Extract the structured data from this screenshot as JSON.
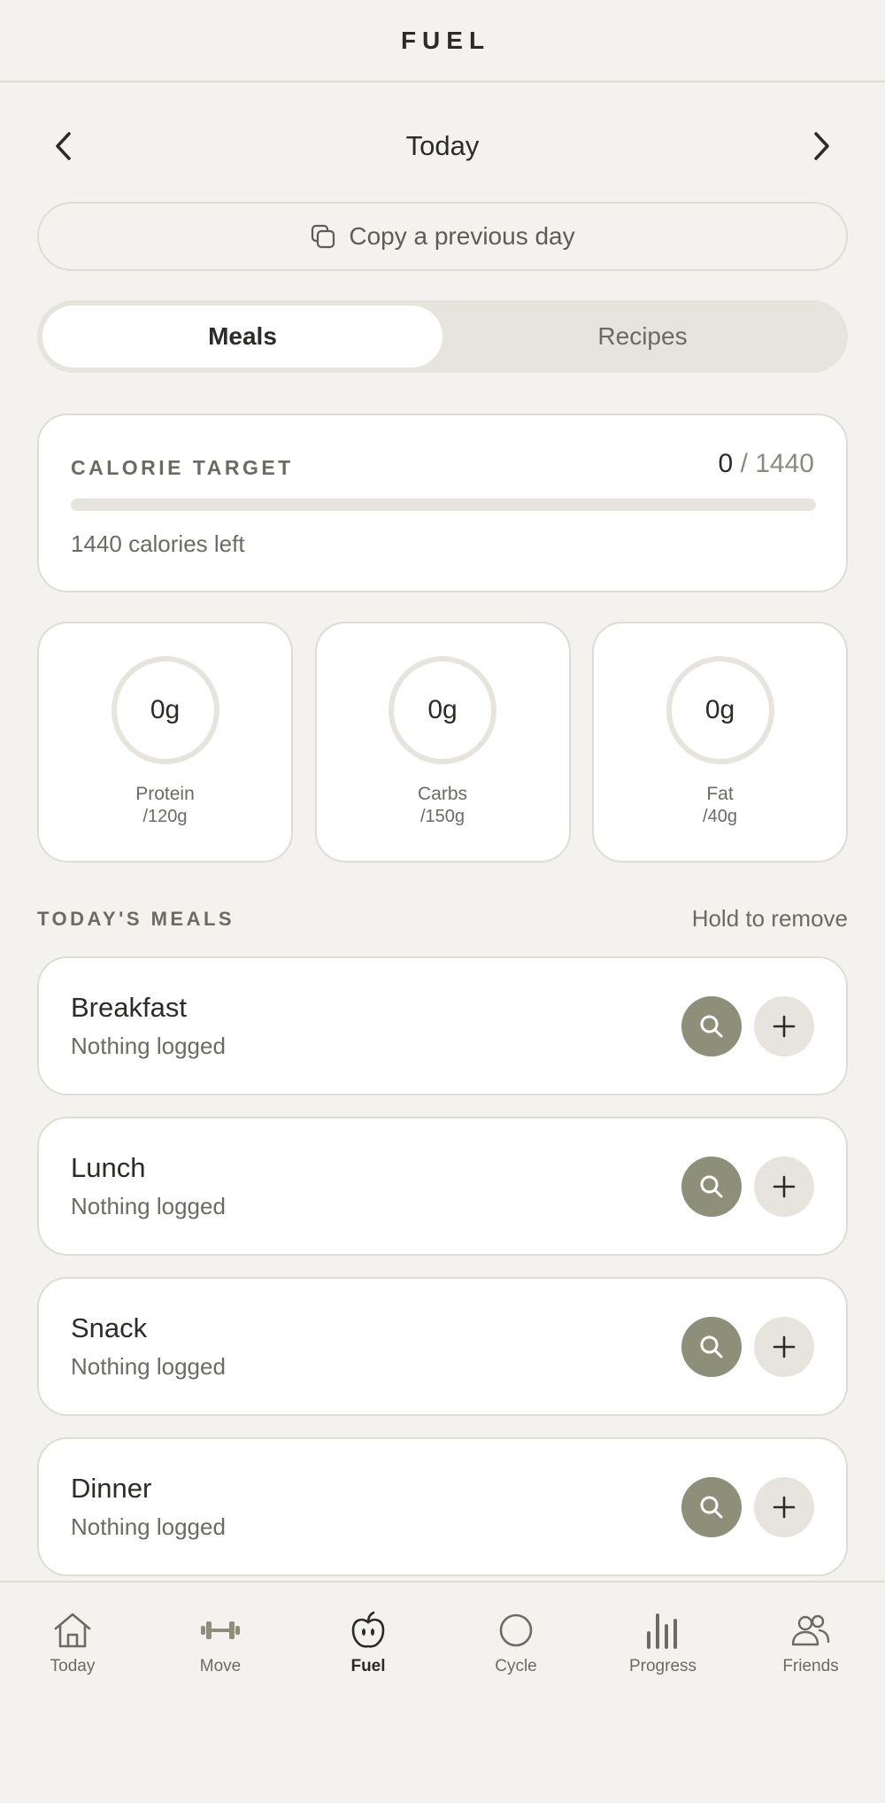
{
  "header": {
    "brand": "FUEL"
  },
  "day_nav": {
    "title": "Today",
    "prev_icon": "chevron-left-icon",
    "next_icon": "chevron-right-icon"
  },
  "copy_button": {
    "label": "Copy a previous day",
    "icon": "copy-icon"
  },
  "segment": {
    "tabs": [
      {
        "label": "Meals",
        "active": true
      },
      {
        "label": "Recipes",
        "active": false
      }
    ]
  },
  "calorie_target": {
    "label": "CALORIE TARGET",
    "current": "0",
    "separator": "/",
    "target": "1440",
    "progress": 0,
    "left_text": "1440 calories left"
  },
  "macros": [
    {
      "value": "0g",
      "name": "Protein",
      "target": "/120g"
    },
    {
      "value": "0g",
      "name": "Carbs",
      "target": "/150g"
    },
    {
      "value": "0g",
      "name": "Fat",
      "target": "/40g"
    }
  ],
  "meals_section": {
    "title": "TODAY'S MEALS",
    "hint": "Hold to remove"
  },
  "meals": [
    {
      "name": "Breakfast",
      "status": "Nothing logged"
    },
    {
      "name": "Lunch",
      "status": "Nothing logged"
    },
    {
      "name": "Snack",
      "status": "Nothing logged"
    },
    {
      "name": "Dinner",
      "status": "Nothing logged"
    }
  ],
  "tabbar": {
    "items": [
      {
        "label": "Today",
        "icon": "home-icon",
        "active": false
      },
      {
        "label": "Move",
        "icon": "dumbbell-icon",
        "active": false
      },
      {
        "label": "Fuel",
        "icon": "apple-icon",
        "active": true
      },
      {
        "label": "Cycle",
        "icon": "circle-icon",
        "active": false
      },
      {
        "label": "Progress",
        "icon": "bar-chart-icon",
        "active": false
      },
      {
        "label": "Friends",
        "icon": "users-icon",
        "active": false
      }
    ]
  },
  "colors": {
    "background": "#f3f2ee",
    "accent": "#8d8f78",
    "card": "#ffffff",
    "muted": "#e6e4dc"
  }
}
